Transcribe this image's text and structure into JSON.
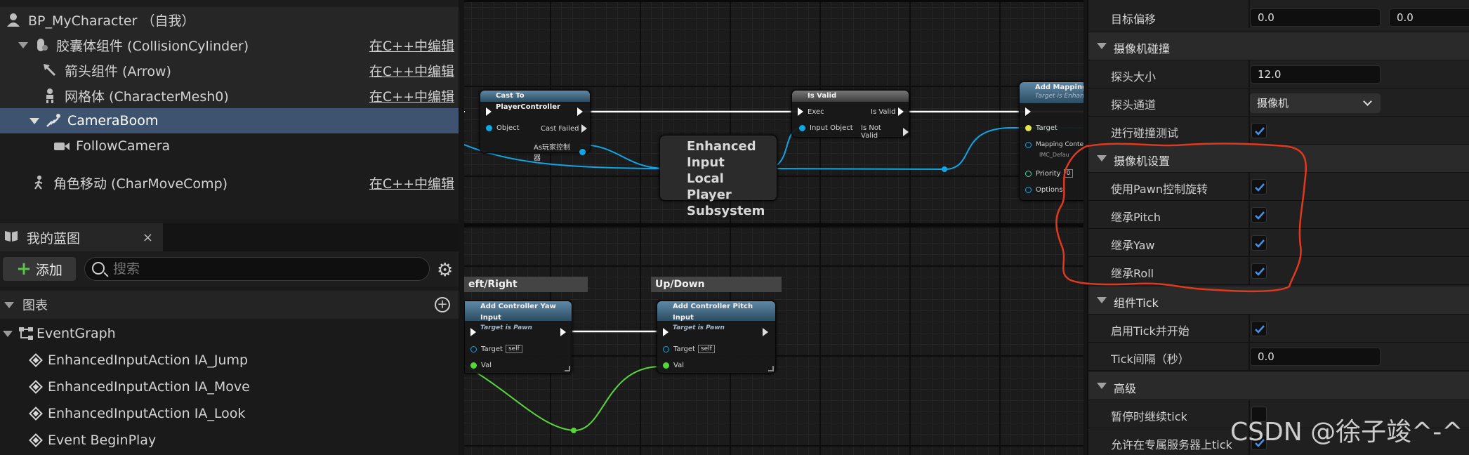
{
  "components": {
    "root": "BP_MyCharacter （自我）",
    "items": [
      {
        "label": "胶囊体组件 (CollisionCylinder)",
        "edit": "在C++中编辑"
      },
      {
        "label": "箭头组件 (Arrow)",
        "edit": "在C++中编辑"
      },
      {
        "label": "网格体 (CharacterMesh0)",
        "edit": "在C++中编辑"
      },
      {
        "label": "CameraBoom",
        "edit": ""
      },
      {
        "label": "FollowCamera",
        "edit": ""
      },
      {
        "label": "角色移动 (CharMoveComp)",
        "edit": "在C++中编辑"
      }
    ]
  },
  "my_blueprint": {
    "tab_label": "我的蓝图",
    "close": "×",
    "add_label": "添加",
    "search_placeholder": "搜索",
    "section": "图表",
    "graph": "EventGraph",
    "events": [
      "EnhancedInputAction IA_Jump",
      "EnhancedInputAction IA_Move",
      "EnhancedInputAction IA_Look",
      "Event BeginPlay"
    ]
  },
  "graph_nodes": {
    "cast": {
      "title": "Cast To PlayerController",
      "object": "Object",
      "cast_failed": "Cast Failed",
      "as": "As玩家控制器"
    },
    "subsystem": {
      "title": "Enhanced Input Local Player Subsystem"
    },
    "isvalid": {
      "title": "Is Valid",
      "exec": "Exec",
      "is_valid": "Is Valid",
      "input": "Input Object",
      "not_valid": "Is Not Valid"
    },
    "mapping": {
      "title": "Add Mapping C",
      "sub": "Target is Enhanc",
      "target": "Target",
      "context": "Mapping Conte",
      "context_val": "IMC_Defau",
      "priority": "Priority",
      "priority_val": "0",
      "options": "Options"
    },
    "comment_left": "eft/Right",
    "comment_right": "Up/Down",
    "yaw": {
      "title": "Add Controller Yaw Input",
      "sub": "Target is Pawn",
      "target": "Target",
      "self": "self",
      "val": "Val"
    },
    "pitch": {
      "title": "Add Controller Pitch Input",
      "sub": "Target is Pawn",
      "target": "Target",
      "self": "self",
      "val": "Val"
    }
  },
  "details": {
    "target_offset": {
      "label": "目标偏移",
      "x": "0.0",
      "y": "0.0"
    },
    "cat_collision": "摄像机碰撞",
    "probe_size": {
      "label": "探头大小",
      "value": "12.0"
    },
    "probe_channel": {
      "label": "探头通道",
      "value": "摄像机"
    },
    "do_collision": {
      "label": "进行碰撞测试",
      "checked": true
    },
    "cat_camera": "摄像机设置",
    "use_pawn_rot": {
      "label": "使用Pawn控制旋转",
      "checked": true
    },
    "inherit_pitch": {
      "label": "继承Pitch",
      "checked": true
    },
    "inherit_yaw": {
      "label": "继承Yaw",
      "checked": true
    },
    "inherit_roll": {
      "label": "继承Roll",
      "checked": true
    },
    "cat_tick": "组件Tick",
    "start_tick": {
      "label": "启用Tick并开始",
      "checked": true
    },
    "tick_interval": {
      "label": "Tick间隔（秒）",
      "value": "0.0"
    },
    "cat_advanced": "高级",
    "tick_paused": {
      "label": "暂停时继续tick",
      "checked": false
    },
    "tick_server": {
      "label": "允许在专属服务器上tick",
      "checked": true
    }
  },
  "watermark": "CSDN @徐子竣^-^",
  "colors": {
    "selected": "#3e5370",
    "exec": "#ffffff",
    "object_pin": "#0fa6e6",
    "float_pin": "#58d73a",
    "annotation": "#e03a1e",
    "check": "#4a90e2"
  }
}
